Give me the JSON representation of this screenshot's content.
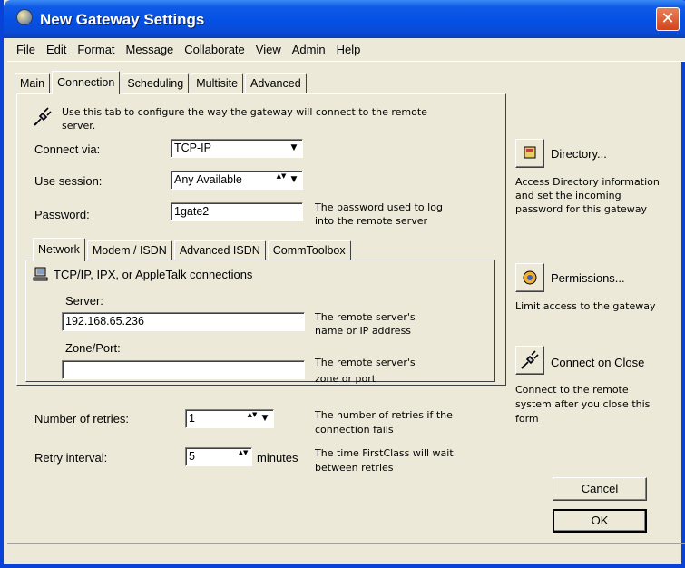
{
  "window": {
    "title": "New Gateway Settings",
    "close_glyph": "✕"
  },
  "menubar": [
    "File",
    "Edit",
    "Format",
    "Message",
    "Collaborate",
    "View",
    "Admin",
    "Help"
  ],
  "main_tabs": [
    "Main",
    "Connection",
    "Scheduling",
    "Multisite",
    "Advanced"
  ],
  "main_tabs_active": "Connection",
  "connection": {
    "intro_line1": "Use this tab to configure the way the gateway will connect to the remote",
    "intro_line2": "server.",
    "connect_via_label": "Connect via:",
    "connect_via_value": "TCP-IP",
    "use_session_label": "Use session:",
    "use_session_value": "Any Available",
    "password_label": "Password:",
    "password_value": "1gate2",
    "password_help_line1": "The password used to log",
    "password_help_line2": "into the remote server"
  },
  "sub_tabs": [
    "Network",
    "Modem / ISDN",
    "Advanced ISDN",
    "CommToolbox"
  ],
  "sub_tabs_active": "Network",
  "network": {
    "heading": "TCP/IP, IPX, or AppleTalk connections",
    "server_label": "Server:",
    "server_value": "192.168.65.236",
    "server_help_line1": "The remote server's",
    "server_help_line2": "name or IP address",
    "zone_label": "Zone/Port:",
    "zone_value": "",
    "zone_help_line1": "The remote server's",
    "zone_help_line2": "zone or port"
  },
  "retries": {
    "label": "Number of retries:",
    "value": "1",
    "help_line1": "The number of retries if the",
    "help_line2": "connection fails"
  },
  "interval": {
    "label": "Retry interval:",
    "value": "5",
    "unit": "minutes",
    "help_line1": "The time FirstClass will wait",
    "help_line2": "between retries"
  },
  "side": {
    "directory_label": "Directory...",
    "directory_help_line1": "Access Directory information",
    "directory_help_line2": "and set the incoming",
    "directory_help_line3": "password for this gateway",
    "permissions_label": "Permissions...",
    "permissions_help": "Limit access to the gateway",
    "connect_label": "Connect on Close",
    "connect_help_line1": "Connect to the remote",
    "connect_help_line2": "system after you close this",
    "connect_help_line3": "form"
  },
  "buttons": {
    "cancel": "Cancel",
    "ok": "OK"
  },
  "icons": {
    "spin_glyph": "▲▼",
    "dropdown_glyph": "▼"
  },
  "colors": {
    "titlebar": "#0550E4",
    "close": "#D2441C",
    "face": "#ECE9D8"
  }
}
